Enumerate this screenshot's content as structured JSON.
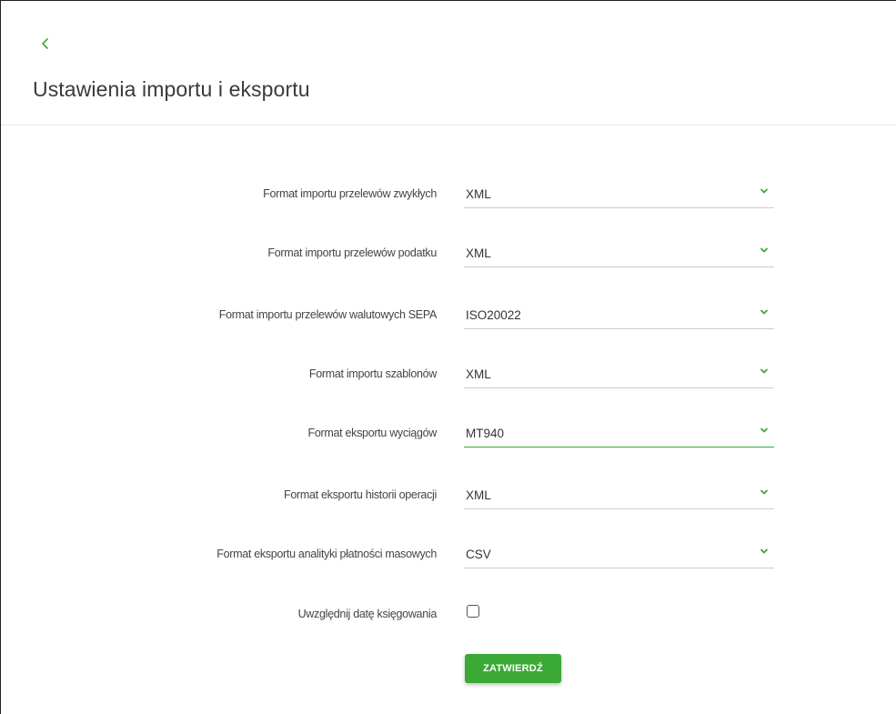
{
  "colors": {
    "accent": "#3aa935",
    "divider": "#e6e6e6",
    "field_underline": "#cccccc"
  },
  "header": {
    "back_icon": "chevron-left-icon",
    "title": "Ustawienia importu i eksportu"
  },
  "form": {
    "fields": [
      {
        "label": "Format importu przelewów zwykłych",
        "value": "XML",
        "focused": false
      },
      {
        "label": "Format importu przelewów podatku",
        "value": "XML",
        "focused": false
      },
      {
        "label": "Format importu przelewów walutowych SEPA",
        "value": "ISO20022",
        "focused": false
      },
      {
        "label": "Format importu szablonów",
        "value": "XML",
        "focused": false
      },
      {
        "label": "Format eksportu wyciągów",
        "value": "MT940",
        "focused": true
      },
      {
        "label": "Format eksportu historii operacji",
        "value": "XML",
        "focused": false
      },
      {
        "label": "Format eksportu analityki płatności masowych",
        "value": "CSV",
        "focused": false
      }
    ],
    "checkbox": {
      "label": "Uwzględnij datę księgowania",
      "checked": false
    },
    "submit_label": "ZATWIERDŹ"
  }
}
